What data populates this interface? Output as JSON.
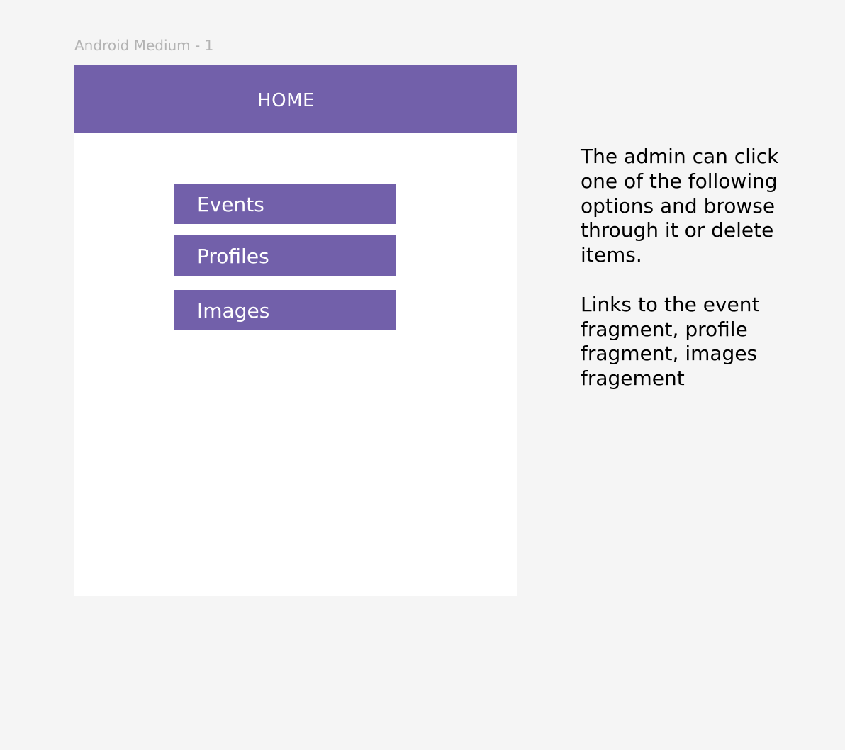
{
  "canvas": {
    "frame_label": "Android Medium - 1"
  },
  "app_bar": {
    "title": "HOME"
  },
  "menu": {
    "items": [
      {
        "label": "Events"
      },
      {
        "label": "Profiles"
      },
      {
        "label": "Images"
      }
    ]
  },
  "annotation": {
    "paragraph_1": "The admin can click one of the following options and browse through it or delete items.",
    "paragraph_2": "Links to the event fragment, profile fragment, images fragement"
  },
  "colors": {
    "canvas_background": "#f5f5f5",
    "primary": "#7260aa",
    "device_background": "#ffffff",
    "label_gray": "#b3b3b3"
  }
}
